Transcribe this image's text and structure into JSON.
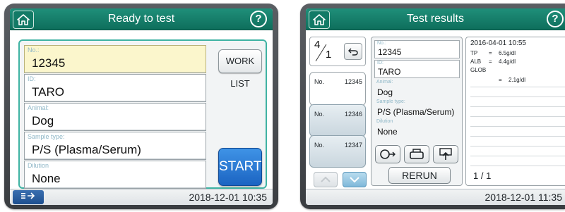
{
  "left_screen": {
    "title": "Ready to test",
    "help": "?",
    "fields": [
      {
        "label": "No.:",
        "value": "12345"
      },
      {
        "label": "ID:",
        "value": "TARO"
      },
      {
        "label": "Animal:",
        "value": "Dog"
      },
      {
        "label": "Sample type:",
        "value": "P/S (Plasma/Serum)"
      },
      {
        "label": "Dilution",
        "value": "None"
      }
    ],
    "worklist_label": "WORK LIST",
    "start_label": "START",
    "footer_time": "2018-12-01 10:35"
  },
  "right_screen": {
    "title": "Test results",
    "help": "?",
    "counter": {
      "current": "4",
      "total": "1"
    },
    "samples": [
      {
        "label": "No.",
        "value": "12345"
      },
      {
        "label": "No.",
        "value": "12346"
      },
      {
        "label": "No.",
        "value": "12347"
      }
    ],
    "details": [
      {
        "label": "No.:",
        "value": "12345"
      },
      {
        "label": "ID:",
        "value": "TARO"
      },
      {
        "label": "Animal:",
        "value": "Dog"
      },
      {
        "label": "Sample type:",
        "value": "P/S (Plasma/Serum)"
      },
      {
        "label": "Dilution",
        "value": "None"
      }
    ],
    "rerun_label": "RERUN",
    "results": {
      "datetime": "2016-04-01  10:55",
      "rows": [
        {
          "name": "TP",
          "eq": "=",
          "value": "6.5g/dl"
        },
        {
          "name": "ALB",
          "eq": "=",
          "value": "4.4g/dl"
        },
        {
          "name": "GLOB",
          "eq": "",
          "value": ""
        },
        {
          "name": "",
          "eq": "=",
          "value": "2.1g/dl"
        }
      ],
      "page": "1 / 1"
    },
    "footer_time": "2018-12-01 11:35"
  }
}
